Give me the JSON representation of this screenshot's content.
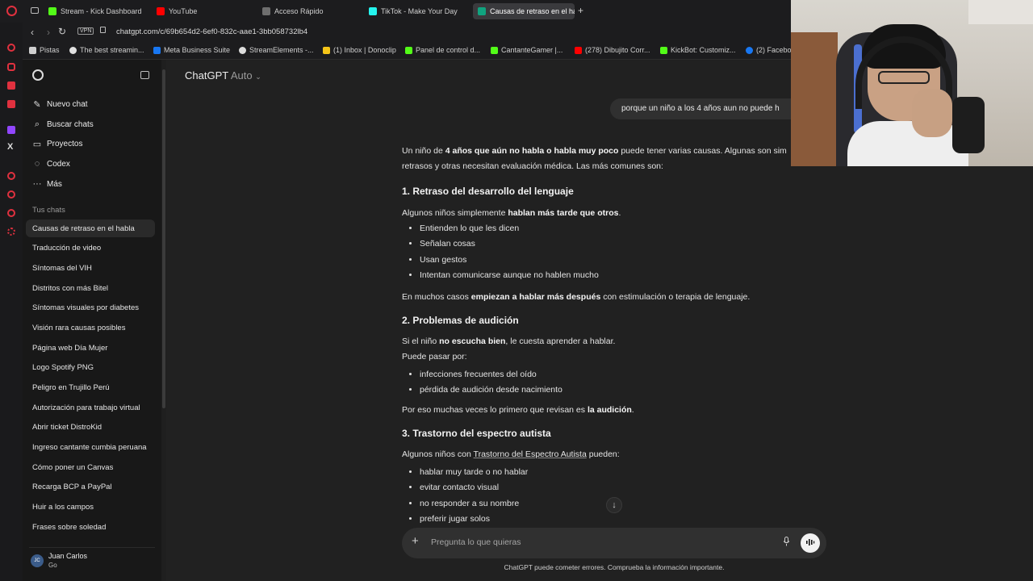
{
  "browser": {
    "tabs": [
      {
        "label": "Stream - Kick Dashboard",
        "color": "#53fc18"
      },
      {
        "label": "YouTube",
        "color": "#ff0000"
      },
      {
        "label": "Acceso Rápido",
        "color": "#8a8a8a"
      },
      {
        "label": "TikTok - Make Your Day",
        "color": "#111111"
      },
      {
        "label": "Causas de retraso en el ha",
        "color": "#ffffff",
        "active": true
      }
    ],
    "url": "chatgpt.com/c/69b654d2-6ef0-832c-aae1-3bb058732lb4",
    "vpn": "VPN",
    "bookmarks": [
      "Pistas",
      "The best streamin...",
      "Meta Business Suite",
      "StreamElements -...",
      "(1) Inbox | Donoclip",
      "Panel de control d...",
      "CantanteGamer |...",
      "(278) Dibujito Corr...",
      "KickBot: Customiz...",
      "(2) Facebo"
    ]
  },
  "sidebar": {
    "new_chat": "Nuevo chat",
    "search_chats": "Buscar chats",
    "projects": "Proyectos",
    "codex": "Codex",
    "more": "Más",
    "section_title": "Tus chats",
    "chats": [
      "Causas de retraso en el habla",
      "Traducción de video",
      "Síntomas del VIH",
      "Distritos con más Bitel",
      "Síntomas visuales por diabetes",
      "Visión rara causas posibles",
      "Página web Día Mujer",
      "Logo Spotify PNG",
      "Peligro en Trujillo Perú",
      "Autorización para trabajo virtual",
      "Abrir ticket DistroKid",
      "Ingreso cantante cumbia peruana",
      "Cómo poner un Canvas",
      "Recarga BCP a PayPal",
      "Huir a los campos",
      "Frases sobre soledad"
    ],
    "user": {
      "initials": "JC",
      "name": "Juan Carlos",
      "plan": "Go"
    }
  },
  "main": {
    "model": "ChatGPT",
    "model_mode": "Auto",
    "user_message": "porque un niño a los 4 años aun no puede h",
    "answer": {
      "intro_1a": "Un niño de ",
      "intro_1b": "4 años que aún no habla o habla muy poco",
      "intro_1c": " puede tener varias causas. Algunas son sim",
      "intro_2": "retrasos y otras necesitan evaluación médica. Las más comunes son:",
      "h1": "1. Retraso del desarrollo del lenguaje",
      "p1a": "Algunos niños simplemente ",
      "p1b": "hablan más tarde que otros",
      "p1c": ".",
      "list1": [
        "Entienden lo que les dicen",
        "Señalan cosas",
        "Usan gestos",
        "Intentan comunicarse aunque no hablen mucho"
      ],
      "p2a": "En muchos casos ",
      "p2b": "empiezan a hablar más después",
      "p2c": " con estimulación o terapia de lenguaje.",
      "h2": "2. Problemas de audición",
      "p3a": "Si el niño ",
      "p3b": "no escucha bien",
      "p3c": ", le cuesta aprender a hablar.",
      "p4": "Puede pasar por:",
      "list2": [
        "infecciones frecuentes del oído",
        "pérdida de audición desde nacimiento"
      ],
      "p5a": "Por eso muchas veces lo primero que revisan es ",
      "p5b": "la audición",
      "p5c": ".",
      "h3": "3. Trastorno del espectro autista",
      "p6a": "Algunos niños con ",
      "p6b": "Trastorno del Espectro Autista",
      "p6c": " pueden:",
      "list3": [
        "hablar muy tarde o no hablar",
        "evitar contacto visual",
        "no responder a su nombre",
        "preferir jugar solos"
      ]
    },
    "composer_placeholder": "Pregunta lo que quieras",
    "disclaimer": "ChatGPT puede cometer errores. Comprueba la información importante."
  }
}
